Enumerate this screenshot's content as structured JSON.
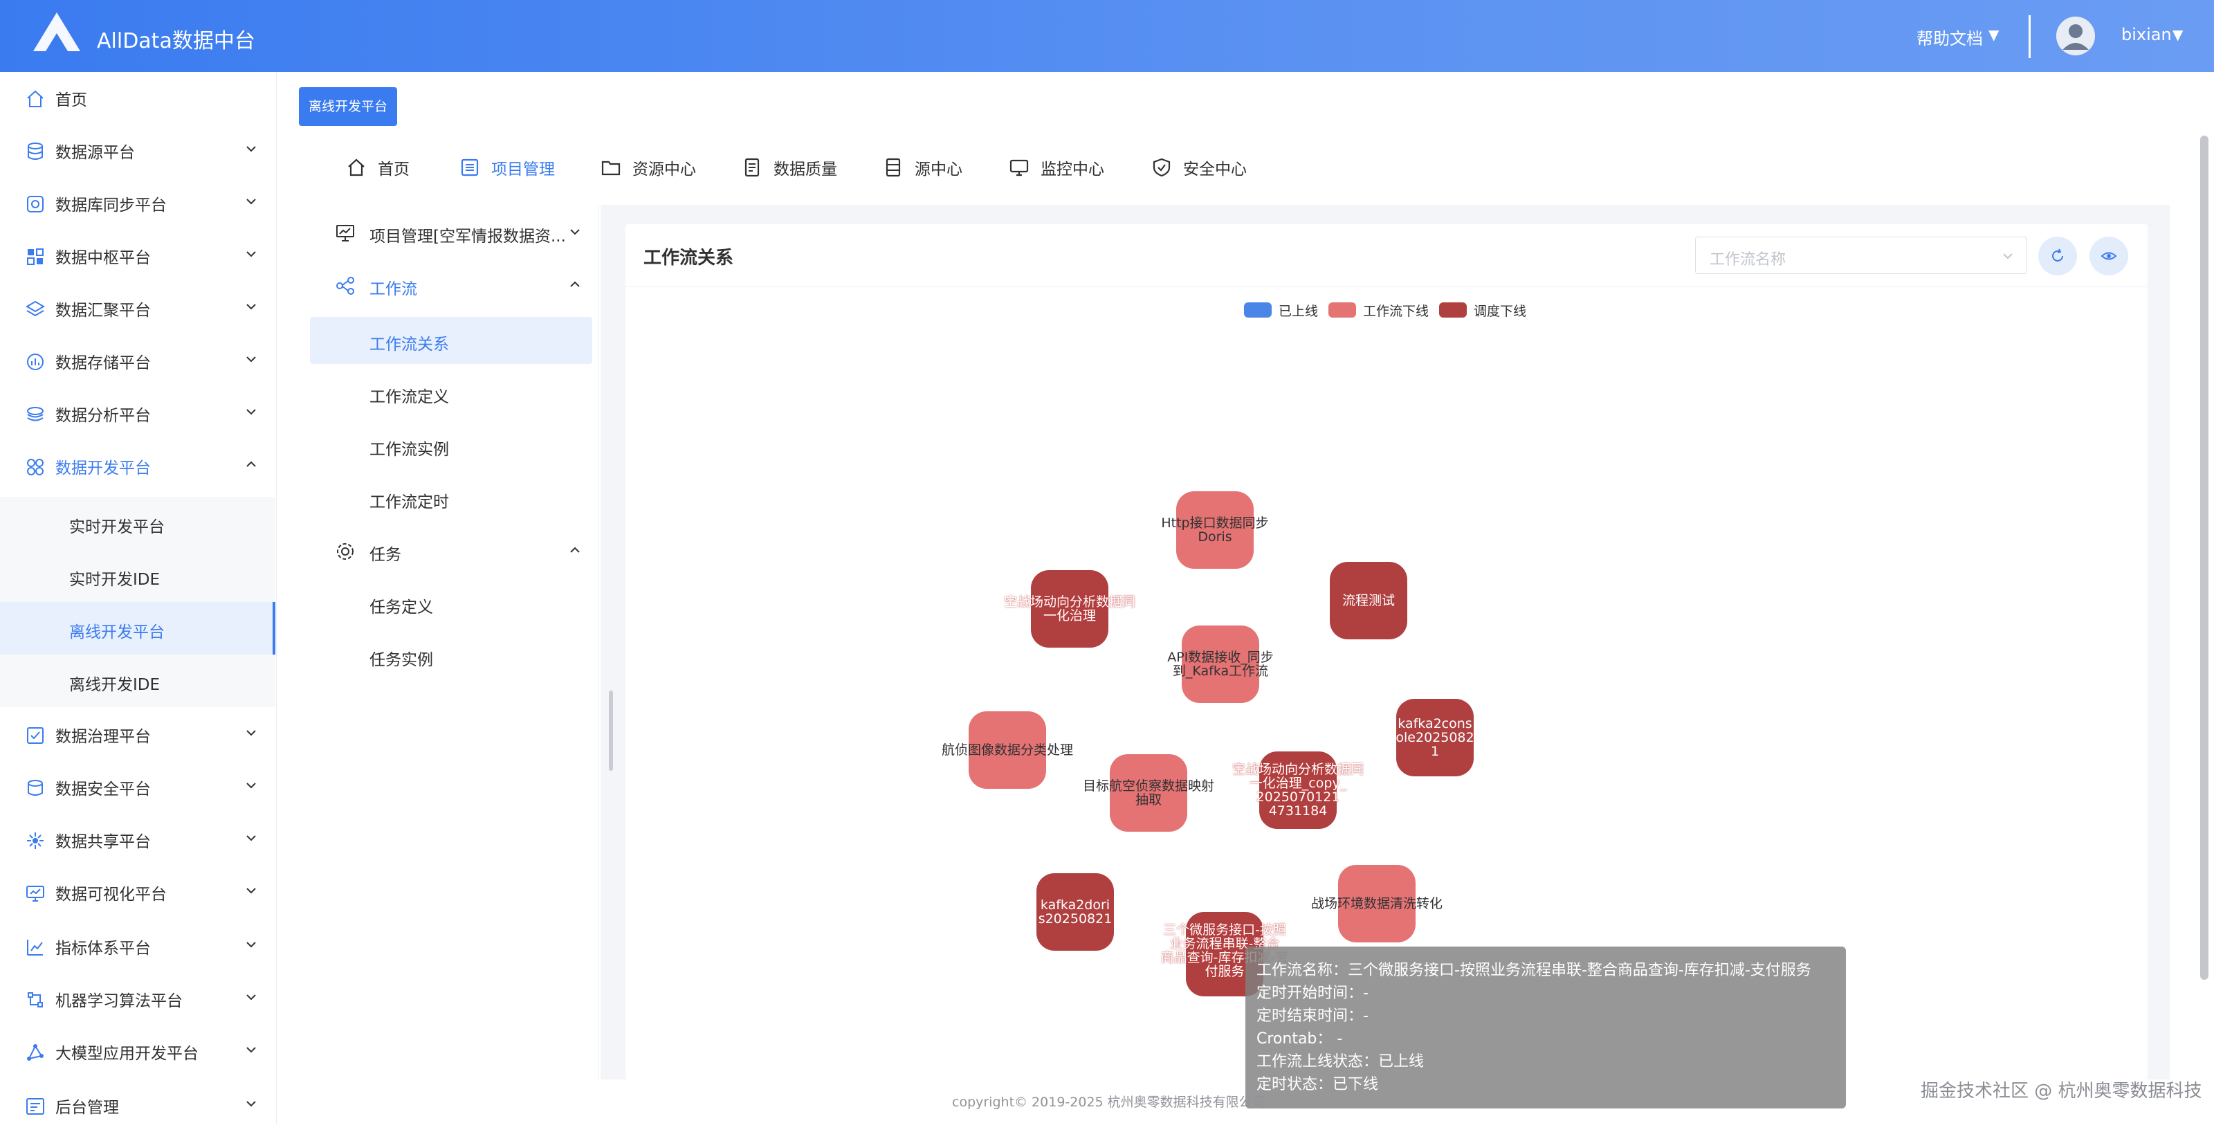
{
  "header": {
    "app_title": "AllData数据中台",
    "help_label": "帮助文档",
    "username": "bixian"
  },
  "sidebar": {
    "items": [
      {
        "label": "首页",
        "icon": "home-icon"
      },
      {
        "label": "数据源平台",
        "icon": "database-icon"
      },
      {
        "label": "数据库同步平台",
        "icon": "sync-icon"
      },
      {
        "label": "数据中枢平台",
        "icon": "grid-icon"
      },
      {
        "label": "数据汇聚平台",
        "icon": "layers-icon"
      },
      {
        "label": "数据存储平台",
        "icon": "storage-icon"
      },
      {
        "label": "数据分析平台",
        "icon": "analysis-icon"
      },
      {
        "label": "数据开发平台",
        "icon": "apps-icon"
      },
      {
        "label": "数据治理平台",
        "icon": "governance-icon"
      },
      {
        "label": "数据安全平台",
        "icon": "security-icon"
      },
      {
        "label": "数据共享平台",
        "icon": "share-icon"
      },
      {
        "label": "数据可视化平台",
        "icon": "monitor-icon"
      },
      {
        "label": "指标体系平台",
        "icon": "metrics-icon"
      },
      {
        "label": "机器学习算法平台",
        "icon": "ml-icon"
      },
      {
        "label": "大模型应用开发平台",
        "icon": "llm-icon"
      },
      {
        "label": "后台管理",
        "icon": "admin-icon"
      }
    ],
    "sub_items": [
      "实时开发平台",
      "实时开发IDE",
      "离线开发平台",
      "离线开发IDE"
    ]
  },
  "tag_button": "离线开发平台",
  "topnav": [
    "首页",
    "项目管理",
    "资源中心",
    "数据质量",
    "源中心",
    "监控中心",
    "安全中心"
  ],
  "left_menu": {
    "project": "项目管理[空军情报数据资...",
    "workflow": "工作流",
    "workflow_items": [
      "工作流关系",
      "工作流定义",
      "工作流实例",
      "工作流定时"
    ],
    "task": "任务",
    "task_items": [
      "任务定义",
      "任务实例"
    ]
  },
  "card": {
    "title": "工作流关系",
    "select_placeholder": "工作流名称"
  },
  "legend": [
    {
      "label": "已上线",
      "color": "#4a86e8"
    },
    {
      "label": "工作流下线",
      "color": "#e57373"
    },
    {
      "label": "调度下线",
      "color": "#b04040"
    }
  ],
  "nodes": [
    {
      "label": "Http接口数据同步\nDoris",
      "status": "工作流下线"
    },
    {
      "label": "空战场动向分析数据同\n一化治理",
      "status": "调度下线"
    },
    {
      "label": "流程测试",
      "status": "调度下线"
    },
    {
      "label": "API数据接收_同步\n到_Kafka工作流",
      "status": "工作流下线"
    },
    {
      "label": "航侦图像数据分类处理",
      "status": "工作流下线"
    },
    {
      "label": "kafka2cons\nole2025082\n1",
      "status": "调度下线"
    },
    {
      "label": "空战场动向分析数据同\n一化治理_copy_\n2025070121\n4731184",
      "status": "调度下线"
    },
    {
      "label": "目标航空侦察数据映射\n抽取",
      "status": "工作流下线"
    },
    {
      "label": "战场环境数据清洗转化",
      "status": "工作流下线"
    },
    {
      "label": "kafka2dori\ns20250821",
      "status": "调度下线"
    },
    {
      "label": "三个微服务接口-按照\n业务流程串联-整合\n商品查询-库存扣减-支\n付服务",
      "status": "调度下线"
    }
  ],
  "tooltip": {
    "line1": "工作流名称：三个微服务接口-按照业务流程串联-整合商品查询-库存扣减-支付服务",
    "line2": "定时开始时间：-",
    "line3": "定时结束时间：-",
    "line4": "Crontab： -",
    "line5": "工作流上线状态：已上线",
    "line6": "定时状态：已下线"
  },
  "footer": {
    "copyright": "copyright© 2019-2025 杭州奥零数据科技有限公司",
    "watermark": "掘金技术社区 @ 杭州奥零数据科技"
  }
}
